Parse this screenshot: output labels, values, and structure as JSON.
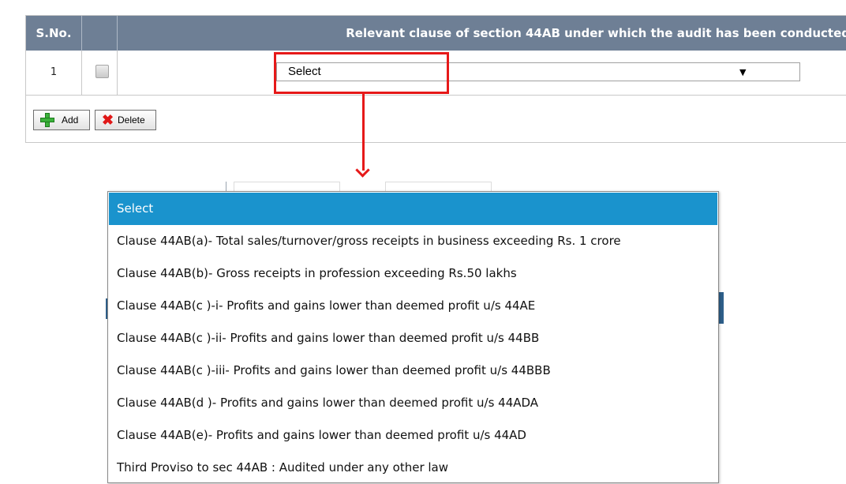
{
  "table": {
    "header_sno": "S.No.",
    "header_clause": "Relevant clause of section 44AB under which the audit has been conducted",
    "row_sno": "1",
    "selected_value": "Select"
  },
  "buttons": {
    "add_label": "Add",
    "delete_label": "Delete"
  },
  "dropdown": {
    "options": [
      "Select",
      "Clause 44AB(a)- Total sales/turnover/gross receipts in business exceeding Rs. 1 crore",
      "Clause 44AB(b)- Gross receipts in profession exceeding Rs.50 lakhs",
      "Clause 44AB(c )-i- Profits and gains lower than deemed profit u/s 44AE",
      "Clause 44AB(c )-ii- Profits and gains lower than deemed profit u/s 44BB",
      "Clause 44AB(c )-iii- Profits and gains lower than deemed profit u/s 44BBB",
      "Clause 44AB(d )- Profits and gains lower than deemed profit u/s 44ADA",
      "Clause 44AB(e)- Profits and gains lower than deemed profit u/s 44AD",
      "Third Proviso to sec 44AB : Audited under any other law"
    ],
    "highlighted_index": 0
  },
  "colors": {
    "header_bg": "#6e7f95",
    "annotation_red": "#e61919",
    "selected_option_bg": "#1a93cd"
  }
}
